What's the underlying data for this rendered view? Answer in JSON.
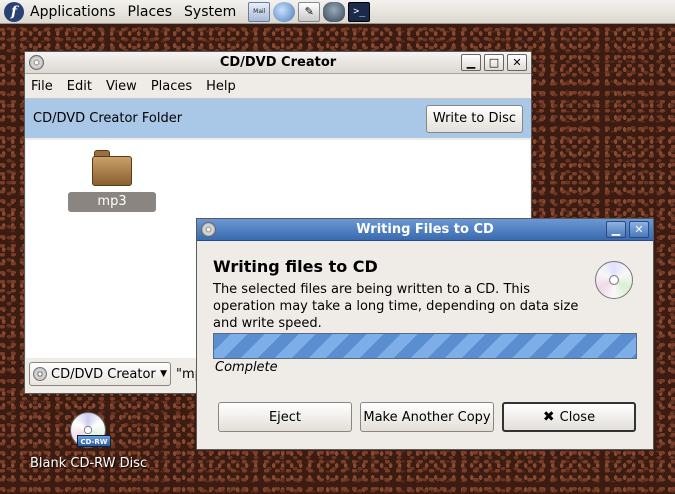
{
  "top_panel": {
    "logo": "f",
    "menus": [
      "Applications",
      "Places",
      "System"
    ],
    "launchers": [
      {
        "name": "mail-launcher-icon",
        "label": "Mail"
      },
      {
        "name": "network-launcher-icon",
        "label": ""
      },
      {
        "name": "writer-launcher-icon",
        "label": ""
      },
      {
        "name": "education-launcher-icon",
        "label": ""
      },
      {
        "name": "terminal-launcher-icon",
        "label": ">_"
      }
    ]
  },
  "creator_window": {
    "title": "CD/DVD Creator",
    "menu": [
      "File",
      "Edit",
      "View",
      "Places",
      "Help"
    ],
    "folder_bar_title": "CD/DVD Creator Folder",
    "write_button": "Write to Disc",
    "items": [
      {
        "label": "mp3",
        "icon": "folder-icon"
      }
    ],
    "location_combo": "CD/DVD Creator",
    "status_text": "\"mp"
  },
  "dialog": {
    "title": "Writing Files to CD",
    "heading": "Writing files to CD",
    "text": "The selected files are being written to a CD.  This operation may take a long time, depending on data size and write speed.",
    "progress": 1.0,
    "progress_label": "Complete",
    "buttons": {
      "eject": "Eject",
      "copy": "Make Another Copy",
      "close": "Close"
    }
  },
  "desktop": {
    "icon_label": "Blank CD-RW Disc",
    "icon_badge": "CD-RW"
  },
  "colors": {
    "active_titlebar": "#3a6ab0",
    "folder_bar": "#a9c7e6",
    "progress": "#5a8ed0"
  }
}
